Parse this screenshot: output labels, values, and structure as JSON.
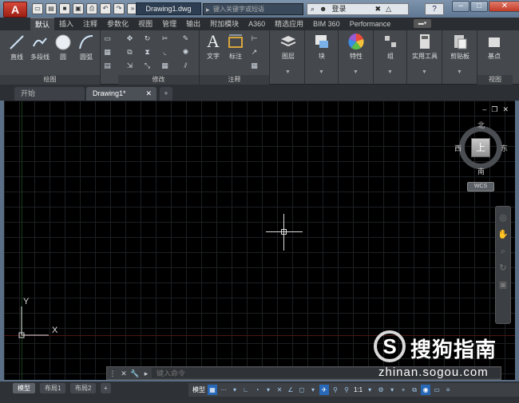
{
  "app": {
    "logo_letter": "A"
  },
  "title_bar": {
    "document_title": "Drawing1.dwg",
    "search_placeholder": "键入关键字或短语",
    "account_label": "登录",
    "help_label": "?",
    "min_label": "–",
    "max_label": "□",
    "close_label": "✕"
  },
  "ribbon_tabs": [
    "默认",
    "插入",
    "注释",
    "参数化",
    "视图",
    "管理",
    "输出",
    "附加模块",
    "A360",
    "精选应用",
    "BIM 360",
    "Performance"
  ],
  "ribbon": {
    "panels": {
      "draw": "绘图",
      "modify": "修改",
      "annotation": "注释",
      "layers": "图层",
      "block": "块",
      "properties": "特性",
      "groups": "组",
      "utilities": "实用工具",
      "clipboard": "剪贴板",
      "view": "视图"
    },
    "tools": {
      "line": "直线",
      "polyline": "多段线",
      "circle": "圆",
      "arc": "圆弧",
      "text": "文字",
      "dimension": "标注",
      "layer": "图层",
      "block": "块",
      "properties": "特性",
      "group": "组",
      "utilities": "实用工具",
      "clipboard": "剪贴板",
      "basepoint": "基点"
    }
  },
  "doc_tabs": {
    "start": "开始",
    "drawing": "Drawing1*",
    "add": "+"
  },
  "viewcube": {
    "north": "北",
    "south": "南",
    "east": "东",
    "west": "西",
    "top_face": "上",
    "wcs": "WCS"
  },
  "ucs": {
    "x": "X",
    "y": "Y"
  },
  "command": {
    "placeholder": "键入命令"
  },
  "layout_tabs": [
    "模型",
    "布局1",
    "布局2"
  ],
  "status": {
    "model": "模型",
    "scale": "1:1"
  },
  "watermark": {
    "logo": "S",
    "name": "搜狗指南",
    "url": "zhinan.sogou.com"
  }
}
